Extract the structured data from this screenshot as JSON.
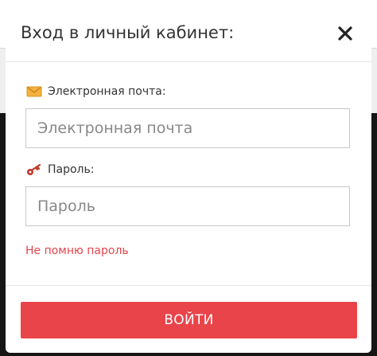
{
  "modal": {
    "title": "Вход в личный кабинет:",
    "close_icon": "close-icon"
  },
  "form": {
    "email": {
      "icon": "envelope-icon",
      "label": "Электронная почта:",
      "placeholder": "Электронная почта",
      "value": ""
    },
    "password": {
      "icon": "key-icon",
      "label": "Пароль:",
      "placeholder": "Пароль",
      "value": ""
    },
    "forgot_link": "Не помню пароль",
    "submit_label": "ВОЙТИ"
  },
  "colors": {
    "accent": "#e8444a",
    "link": "#e4444a",
    "envelope": "#f3b13d",
    "key": "#c0392b",
    "text": "#333333",
    "backdrop": "#161616"
  }
}
